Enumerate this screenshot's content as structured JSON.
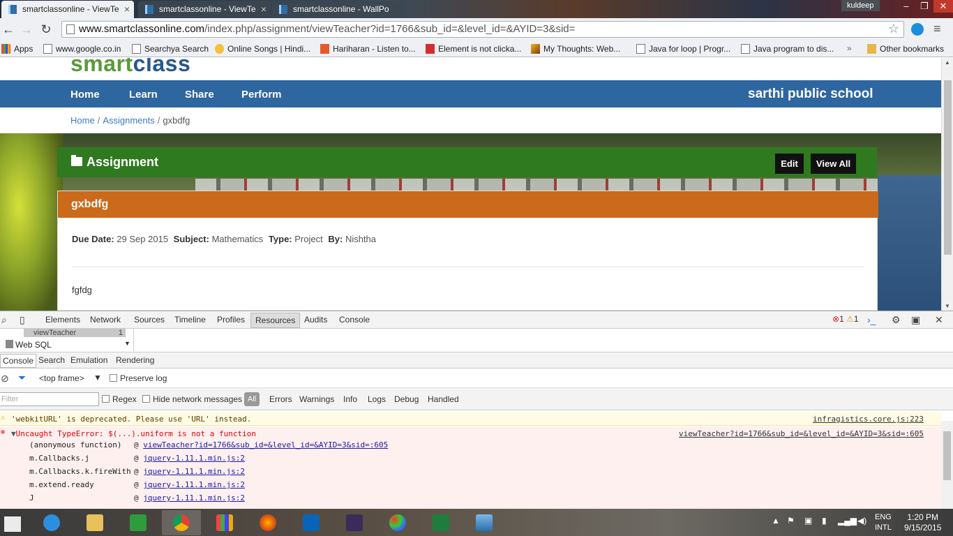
{
  "browser": {
    "tabs": [
      {
        "title": "smartclassonline - ViewTe",
        "active": true
      },
      {
        "title": "smartclassonline - ViewTe",
        "active": false
      },
      {
        "title": "smartclassonline - WallPo",
        "active": false
      }
    ],
    "user": "kuldeep",
    "url_host": "www.smartclassonline.com",
    "url_path": "/index.php/assignment/viewTeacher?id=1766&sub_id=&level_id=&AYID=3&sid=",
    "bookmarks": [
      "Apps",
      "www.google.co.in",
      "Searchya Search",
      "Online Songs | Hindi...",
      "Hariharan - Listen to...",
      "Element is not clicka...",
      "My Thoughts: Web...",
      "Java for loop | Progr...",
      "Java program to dis..."
    ],
    "bookmarks_more": "»",
    "other_bookmarks": "Other bookmarks"
  },
  "site": {
    "logo_part1": "smart",
    "logo_part2": "class",
    "nav": [
      "Home",
      "Learn",
      "Share",
      "Perform"
    ],
    "school": "sarthi public school",
    "breadcrumb": {
      "home": "Home",
      "assignments": "Assignments",
      "current": "gxbdfg",
      "sep": "/"
    },
    "section_title": "Assignment",
    "edit_label": "Edit",
    "view_all_label": "View All",
    "assignment": {
      "title": "gxbdfg",
      "due_label": "Due Date:",
      "due_value": "29 Sep 2015",
      "subject_label": "Subject:",
      "subject_value": "Mathematics",
      "type_label": "Type:",
      "type_value": "Project",
      "by_label": "By:",
      "by_value": "Nishtha",
      "description": "fgfdg"
    }
  },
  "devtools": {
    "tabs": [
      "Elements",
      "Network",
      "Sources",
      "Timeline",
      "Profiles",
      "Resources",
      "Audits",
      "Console"
    ],
    "active_tab": "Resources",
    "error_count": "1",
    "warning_count": "1",
    "resource_item": "viewTeacher",
    "resource_badge": "1",
    "websql": "Web SQL",
    "drawer_tabs": [
      "Console",
      "Search",
      "Emulation",
      "Rendering"
    ],
    "frame": "<top frame>",
    "preserve_log": "Preserve log",
    "filter_placeholder": "Filter",
    "regex": "Regex",
    "hide_network": "Hide network messages",
    "levels": [
      "All",
      "Errors",
      "Warnings",
      "Info",
      "Logs",
      "Debug",
      "Handled"
    ],
    "warning": {
      "text": "'webkitURL' is deprecated. Please use 'URL' instead.",
      "source": "infragistics.core.js:223"
    },
    "error": {
      "text": "Uncaught TypeError: $(...).uniform is not a function",
      "source": "viewTeacher?id=1766&sub_id=&level_id=&AYID=3&sid=:605",
      "stack": [
        {
          "fn": "(anonymous function)",
          "at": "viewTeacher?id=1766&sub_id=&level_id=&AYID=3&sid=:605"
        },
        {
          "fn": "m.Callbacks.j",
          "at": "jquery-1.11.1.min.js:2"
        },
        {
          "fn": "m.Callbacks.k.fireWith",
          "at": "jquery-1.11.1.min.js:2"
        },
        {
          "fn": "m.extend.ready",
          "at": "jquery-1.11.1.min.js:2"
        },
        {
          "fn": "J",
          "at": "jquery-1.11.1.min.js:2"
        }
      ]
    }
  },
  "taskbar": {
    "apps": [
      "ie-icon",
      "file-explorer-icon",
      "store-icon",
      "chrome-icon",
      "apps-icon",
      "firefox-icon",
      "outlook-icon",
      "java-ee-ide-icon",
      "paint-icon",
      "excel-icon",
      "photos-icon"
    ],
    "lang_line1": "ENG",
    "lang_line2": "INTL",
    "time": "1:20 PM",
    "date": "9/15/2015"
  },
  "colors": {
    "nav_blue": "#2e66a0",
    "assign_green": "#2f7a1f",
    "card_orange": "#cb6a1b",
    "error_red": "#d00"
  }
}
